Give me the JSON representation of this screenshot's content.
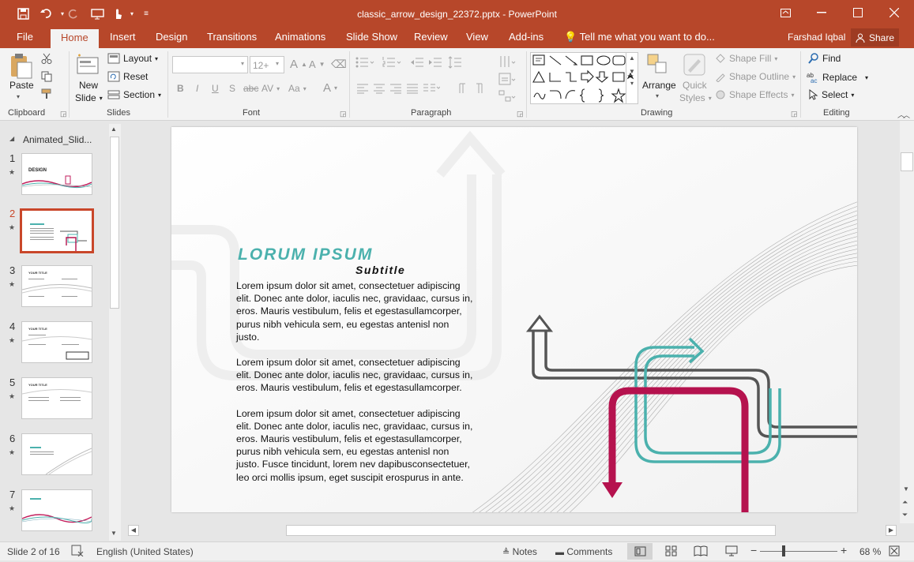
{
  "window": {
    "title": "classic_arrow_design_22372.pptx - PowerPoint"
  },
  "ribbon_tabs": [
    {
      "label": "File"
    },
    {
      "label": "Home"
    },
    {
      "label": "Insert"
    },
    {
      "label": "Design"
    },
    {
      "label": "Transitions"
    },
    {
      "label": "Animations"
    },
    {
      "label": "Slide Show"
    },
    {
      "label": "Review"
    },
    {
      "label": "View"
    },
    {
      "label": "Add-ins"
    }
  ],
  "tell_me": "Tell me what you want to do...",
  "user": "Farshad Iqbal",
  "share_label": "Share",
  "clipboard": {
    "paste": "Paste",
    "label": "Clipboard"
  },
  "slides_group": {
    "new_slide": "New",
    "new_slide2": "Slide",
    "layout": "Layout",
    "reset": "Reset",
    "section": "Section",
    "label": "Slides"
  },
  "font_group": {
    "font_name": "",
    "font_size": "12+",
    "label": "Font",
    "bold": "B",
    "italic": "I",
    "underline": "U",
    "shadow": "S",
    "strike": "abc",
    "spacing": "AV",
    "case": "Aa",
    "color": "A",
    "grow": "A",
    "shrink": "A"
  },
  "paragraph_group": {
    "label": "Paragraph"
  },
  "drawing_group": {
    "arrange": "Arrange",
    "quick_styles": "Quick",
    "quick_styles2": "Styles",
    "shape_fill": "Shape Fill",
    "shape_outline": "Shape Outline",
    "shape_effects": "Shape Effects",
    "label": "Drawing"
  },
  "editing_group": {
    "find": "Find",
    "replace": "Replace",
    "select": "Select",
    "label": "Editing"
  },
  "thumb_pane": {
    "section": "Animated_Slid...",
    "slides": [
      "1",
      "2",
      "3",
      "4",
      "5",
      "6",
      "7"
    ],
    "selected": "2"
  },
  "slide": {
    "title": "LORUM IPSUM",
    "subtitle": "Subtitle",
    "p1": [
      "Lorem ipsum dolor sit amet, consectetuer adipiscing",
      "elit. Donec ante dolor, iaculis nec, gravidaac, cursus in,",
      "eros. Mauris vestibulum, felis et egestasullamcorper,",
      "purus nibh vehicula sem, eu egestas antenisl non",
      "justo."
    ],
    "p2": [
      "Lorem ipsum dolor sit amet, consectetuer adipiscing",
      "elit. Donec ante dolor, iaculis nec, gravidaac, cursus in,",
      "eros. Mauris vestibulum, felis et egestasullamcorper."
    ],
    "p3": [
      "Lorem ipsum dolor sit amet, consectetuer adipiscing",
      "elit. Donec ante dolor, iaculis nec, gravidaac, cursus in,",
      "eros. Mauris vestibulum, felis et egestasullamcorper,",
      "purus nibh vehicula sem, eu egestas antenisl non",
      "justo. Fusce tincidunt, lorem nev dapibusconsectetuer,",
      "leo orci mollis ipsum, eget suscipit erospurus in ante."
    ]
  },
  "status": {
    "slide": "Slide 2 of 16",
    "language": "English (United States)",
    "notes": "Notes",
    "comments": "Comments",
    "zoom": "68 %",
    "zoom_percent": 68
  },
  "colors": {
    "accent": "#b7472a",
    "teal": "#4bb1ad",
    "crimson": "#b5124e",
    "gray_arrow": "#555555"
  }
}
